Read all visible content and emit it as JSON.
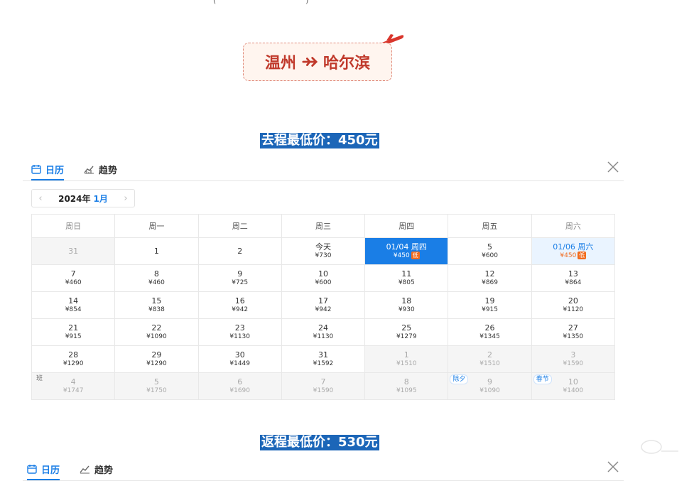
{
  "top_fragment": "(                                    )",
  "route": {
    "from": "温州",
    "to": "哈尔滨"
  },
  "outbound": {
    "title": "去程最低价：450元",
    "tabs": {
      "calendar": "日历",
      "trend": "趋势"
    },
    "nav": {
      "prev": "‹",
      "next": "›",
      "year": "2024年",
      "month": "1月"
    },
    "weekdays": [
      "周日",
      "周一",
      "周二",
      "周三",
      "周四",
      "周五",
      "周六"
    ],
    "rows": [
      [
        {
          "d": "31",
          "p": "",
          "s": "gray"
        },
        {
          "d": "1",
          "p": ""
        },
        {
          "d": "2",
          "p": ""
        },
        {
          "d": "今天",
          "p": "¥730"
        },
        {
          "d": "01/04 周四",
          "p": "¥450",
          "s": "selected",
          "low": "低"
        },
        {
          "d": "5",
          "p": "¥600"
        },
        {
          "d": "01/06 周六",
          "p": "¥450",
          "s": "selected-return",
          "low": "低"
        }
      ],
      [
        {
          "d": "7",
          "p": "¥460"
        },
        {
          "d": "8",
          "p": "¥460"
        },
        {
          "d": "9",
          "p": "¥725"
        },
        {
          "d": "10",
          "p": "¥600"
        },
        {
          "d": "11",
          "p": "¥805"
        },
        {
          "d": "12",
          "p": "¥869"
        },
        {
          "d": "13",
          "p": "¥864"
        }
      ],
      [
        {
          "d": "14",
          "p": "¥854"
        },
        {
          "d": "15",
          "p": "¥838"
        },
        {
          "d": "16",
          "p": "¥942"
        },
        {
          "d": "17",
          "p": "¥942"
        },
        {
          "d": "18",
          "p": "¥930"
        },
        {
          "d": "19",
          "p": "¥915"
        },
        {
          "d": "20",
          "p": "¥1120"
        }
      ],
      [
        {
          "d": "21",
          "p": "¥915"
        },
        {
          "d": "22",
          "p": "¥1090"
        },
        {
          "d": "23",
          "p": "¥1130"
        },
        {
          "d": "24",
          "p": "¥1130"
        },
        {
          "d": "25",
          "p": "¥1279"
        },
        {
          "d": "26",
          "p": "¥1345"
        },
        {
          "d": "27",
          "p": "¥1350"
        }
      ],
      [
        {
          "d": "28",
          "p": "¥1290"
        },
        {
          "d": "29",
          "p": "¥1290"
        },
        {
          "d": "30",
          "p": "¥1449"
        },
        {
          "d": "31",
          "p": "¥1592"
        },
        {
          "d": "1",
          "p": "¥1510",
          "s": "gray"
        },
        {
          "d": "2",
          "p": "¥1510",
          "s": "gray"
        },
        {
          "d": "3",
          "p": "¥1590",
          "s": "gray"
        }
      ],
      [
        {
          "d": "4",
          "p": "¥1747",
          "s": "gray",
          "tag": "班",
          "tagType": "ban"
        },
        {
          "d": "5",
          "p": "¥1750",
          "s": "gray"
        },
        {
          "d": "6",
          "p": "¥1690",
          "s": "gray"
        },
        {
          "d": "7",
          "p": "¥1590",
          "s": "gray"
        },
        {
          "d": "8",
          "p": "¥1095",
          "s": "gray"
        },
        {
          "d": "9",
          "p": "¥1090",
          "s": "gray",
          "tag": "除夕"
        },
        {
          "d": "10",
          "p": "¥1400",
          "s": "gray",
          "tag": "春节"
        }
      ]
    ]
  },
  "return": {
    "title": "返程最低价：530元",
    "tabs": {
      "calendar": "日历",
      "trend": "趋势"
    }
  },
  "colors": {
    "accent": "#1a7ee6",
    "route_red": "#c0392b",
    "low_badge": "#f26b1d",
    "title_bg": "#1c66b8"
  }
}
